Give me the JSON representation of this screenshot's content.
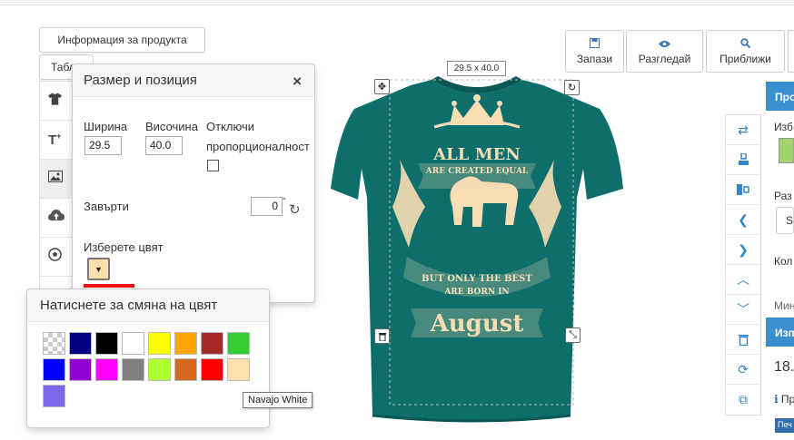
{
  "left_buttons": {
    "info": "Информация за продукта",
    "tab_partial": "Табл"
  },
  "left_icons": [
    "tshirt-icon",
    "text-icon",
    "image-icon",
    "upload-icon",
    "football-icon"
  ],
  "size_panel": {
    "title": "Размер и позиция",
    "close": "×",
    "width_label": "Ширина",
    "width_value": "29.5",
    "height_label": "Височина",
    "height_value": "40.0",
    "disable_label_1": "Отключи",
    "disable_label_2": "пропорционалност",
    "rotate_label": "Завърти",
    "rotate_value": "0",
    "rotate_unit": "°",
    "color_label": "Изберете цвят",
    "selected_color": "#ffdead"
  },
  "palette": {
    "title": "Натиснете за смяна на цвят",
    "colors": [
      {
        "name": "Transparent",
        "hex": "transparent"
      },
      {
        "name": "Navy",
        "hex": "#000080"
      },
      {
        "name": "Black",
        "hex": "#000000"
      },
      {
        "name": "White",
        "hex": "#ffffff"
      },
      {
        "name": "Yellow",
        "hex": "#ffff00"
      },
      {
        "name": "Orange",
        "hex": "#ffa500"
      },
      {
        "name": "Brown",
        "hex": "#a52a2a"
      },
      {
        "name": "Lime Green",
        "hex": "#32cd32"
      },
      {
        "name": "Blue",
        "hex": "#0000ff"
      },
      {
        "name": "Dark Violet",
        "hex": "#9400d3"
      },
      {
        "name": "Magenta",
        "hex": "#ff00ff"
      },
      {
        "name": "Gray",
        "hex": "#808080"
      },
      {
        "name": "Green Yellow",
        "hex": "#adff2f"
      },
      {
        "name": "Chocolate",
        "hex": "#d2691e"
      },
      {
        "name": "Red",
        "hex": "#ff0000"
      },
      {
        "name": "Navajo White",
        "hex": "#ffdead"
      },
      {
        "name": "Medium Slate Blue",
        "hex": "#7b68ee"
      }
    ],
    "tooltip": "Navajo White"
  },
  "canvas": {
    "size_tag": "29.5 x 40.0",
    "shirt_color": "#0e6e6c",
    "print_color": "#f6ddb4",
    "print_lines": [
      "ALL MEN",
      "ARE CREATED EQUAL",
      "BUT ONLY THE BEST",
      "ARE BORN IN",
      "August"
    ]
  },
  "top_right": {
    "save": "Запази",
    "preview": "Разгледай",
    "zoom": "Приближи"
  },
  "right_panel": {
    "head1": "Про",
    "choose": "Изб",
    "size": "Раз",
    "size_value": "S",
    "qty": "Кол",
    "min": "Мин",
    "head2": "Изп",
    "price": "18.",
    "note": "Пр",
    "badge": "Печ"
  }
}
